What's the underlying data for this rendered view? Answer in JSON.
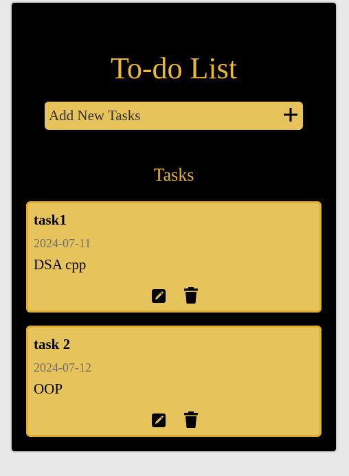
{
  "app": {
    "title": "To-do List",
    "add_placeholder": "Add New Tasks",
    "tasks_heading": "Tasks"
  },
  "icons": {
    "add": "plus-icon",
    "edit": "pencil-square-icon",
    "delete": "trash-icon"
  },
  "colors": {
    "background": "#000000",
    "accent": "#e8b735",
    "card": "#e7c35b",
    "card_border": "#dbae2e",
    "page": "#e8e8e8"
  },
  "tasks": [
    {
      "title": "task1",
      "date": "2024-07-11",
      "description": "DSA cpp"
    },
    {
      "title": "task 2",
      "date": "2024-07-12",
      "description": "OOP"
    }
  ]
}
